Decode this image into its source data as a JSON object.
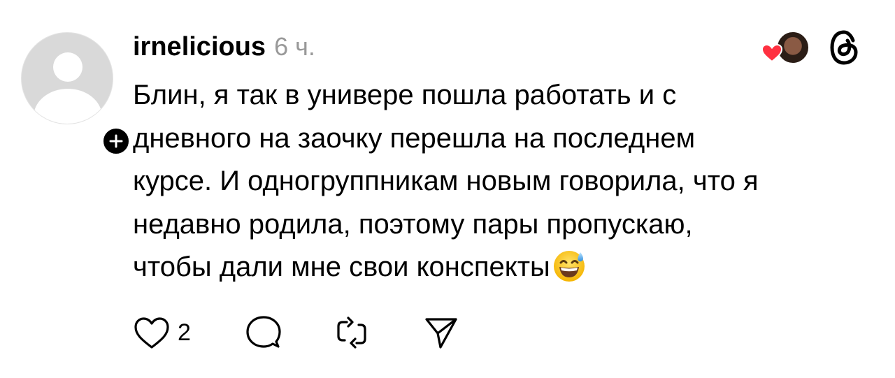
{
  "post": {
    "username": "irnelicious",
    "timestamp": "6 ч.",
    "text_lines": [
      "Блин, я так в универе пошла работать и с",
      "дневного на заочку перешла на последнем",
      "курсе. И одногруппникам новым говорила, что я",
      "недавно родила, поэтому пары пропускаю,",
      "чтобы дали мне свои конспекты"
    ],
    "emoji": "grinning-face-with-sweat",
    "like_count": "2"
  },
  "icons": {
    "avatar": "default-avatar-icon",
    "follow": "plus-icon",
    "liked_by": "heart-icon",
    "app": "threads-icon",
    "like": "heart-outline-icon",
    "comment": "comment-icon",
    "repost": "repost-icon",
    "share": "send-icon"
  },
  "colors": {
    "text": "#000000",
    "muted": "#999999",
    "heart": "#ff3040",
    "avatar_bg": "#d9d9d9"
  }
}
